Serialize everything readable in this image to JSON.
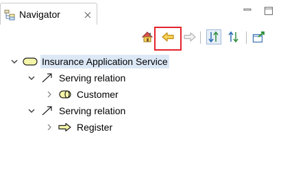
{
  "view": {
    "tab_label": "Navigator",
    "toolbar": {
      "items": [
        {
          "name": "home-button"
        },
        {
          "name": "back-button"
        },
        {
          "name": "forward-button"
        },
        {
          "name": "incoming-relations-button"
        },
        {
          "name": "outgoing-relations-button"
        },
        {
          "name": "link-to-editor-button"
        }
      ]
    }
  },
  "tree": {
    "root": {
      "label": "Insurance Application Service",
      "icon": "application-service-icon",
      "expanded": true,
      "selected": true
    },
    "children": [
      {
        "label": "Serving relation",
        "icon": "serving-relation-icon",
        "expanded": true,
        "child": {
          "label": "Customer",
          "icon": "business-role-icon",
          "expanded": false
        }
      },
      {
        "label": "Serving relation",
        "icon": "serving-relation-icon",
        "expanded": true,
        "child": {
          "label": "Register",
          "icon": "business-process-icon",
          "expanded": false
        }
      }
    ]
  },
  "colors": {
    "highlight_border": "#e3202a",
    "selection_bg": "#dde8f6",
    "service_fill": "#f5f5a8",
    "role_fill": "#f5f5a8",
    "process_fill": "#f5f5a8",
    "toolbar_blue": "#2e6db4",
    "toolbar_green": "#2f8f3a",
    "nav_arrow_fill": "#f7d35a"
  }
}
